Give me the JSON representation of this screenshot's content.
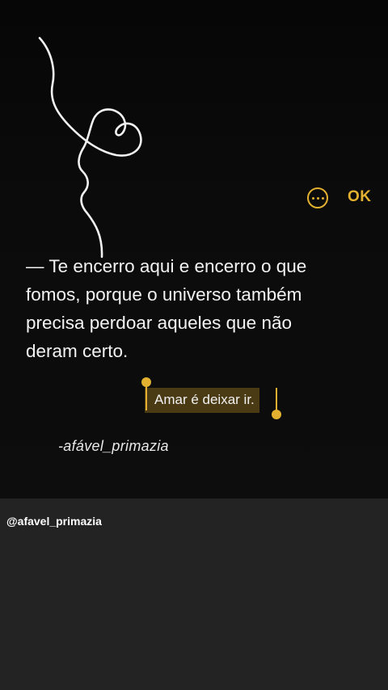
{
  "note": {
    "body": "— Te encerro aqui e encerro o que\nfomos, porque o universo também\nprecisa perdoar  aqueles que não\nderam certo.",
    "selected_text": "Amar é deixar ir.",
    "signature": "-afável_primazia"
  },
  "toolbar": {
    "more_icon": "ellipsis-circle-icon",
    "ok_label": "OK"
  },
  "footer": {
    "handle": "@afavel_primazia"
  },
  "colors": {
    "accent": "#e3b12f",
    "background": "#0b0b0b",
    "footer_background": "#232323",
    "text": "#f3f3f3",
    "selection": "#4a3b14"
  }
}
